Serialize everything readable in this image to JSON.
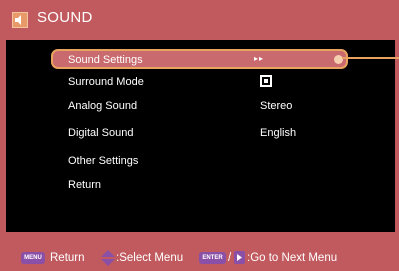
{
  "colors": {
    "frame": "#c05a5e",
    "panel": "#000000",
    "highlight": "#c86a6e",
    "highlight_border": "#e8a35f",
    "key": "#8a50a8",
    "text": "#ffffff"
  },
  "header": {
    "title": "SOUND",
    "icon": "speaker-icon"
  },
  "menu": {
    "items": [
      {
        "label": "Sound Settings",
        "value": "▸▸"
      },
      {
        "label": "Surround Mode",
        "value": ""
      },
      {
        "label": "Analog Sound",
        "value": "Stereo"
      },
      {
        "label": "Digital Sound",
        "value": "English"
      },
      {
        "label": "Other Settings",
        "value": ""
      },
      {
        "label": "Return",
        "value": ""
      }
    ]
  },
  "footer": {
    "menu_key": "MENU",
    "return_label": "Return",
    "select_label": ":Select Menu",
    "enter_key": "ENTER",
    "slash": "/",
    "next_label": ":Go to Next Menu"
  }
}
